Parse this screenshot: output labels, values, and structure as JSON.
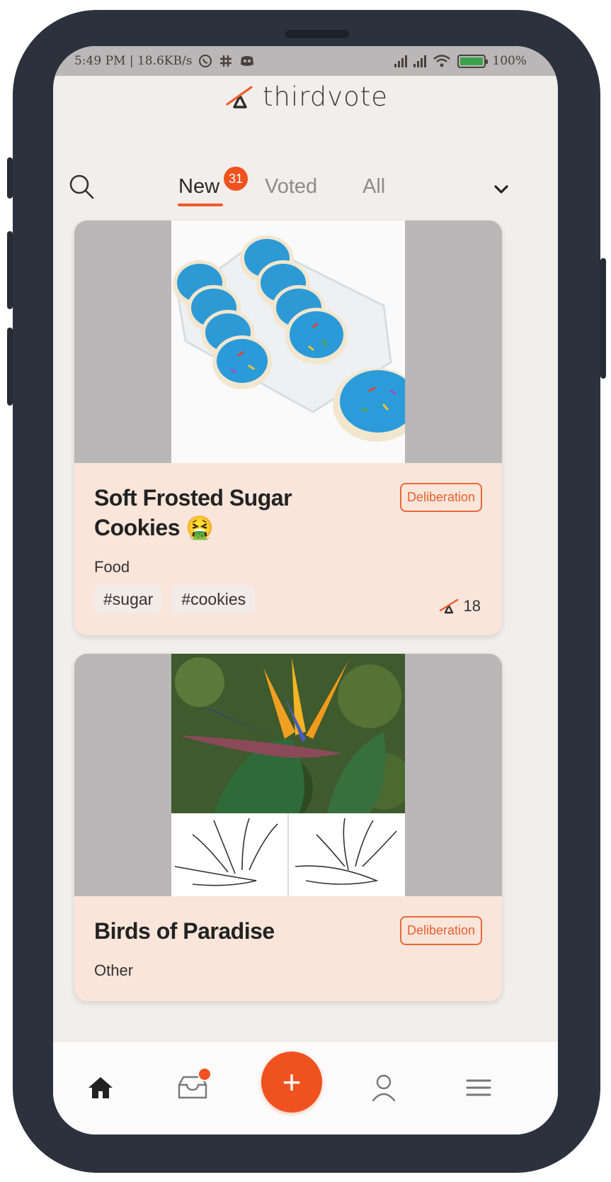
{
  "status_bar": {
    "left_text": "5:49 PM | 18.6KB/s",
    "battery": "100%"
  },
  "brand": {
    "name": "thirdvote"
  },
  "tabs": {
    "items": [
      {
        "label": "New",
        "active": true
      },
      {
        "label": "Voted",
        "active": false
      },
      {
        "label": "All",
        "active": false
      }
    ],
    "new_count": "31"
  },
  "cards": [
    {
      "title": "Soft Frosted Sugar Cookies 🤮",
      "status": "Deliberation",
      "category": "Food",
      "tags": [
        "#sugar",
        "#cookies"
      ],
      "votes": "18"
    },
    {
      "title": "Birds of Paradise",
      "status": "Deliberation",
      "category": "Other",
      "tags": [],
      "votes": ""
    }
  ],
  "colors": {
    "accent": "#f0521f",
    "card_bg": "#f9e5da",
    "screen_bg": "#f1eeeb",
    "phone_frame": "#2b323d"
  },
  "bottom_nav": {
    "items": [
      {
        "icon": "home-icon"
      },
      {
        "icon": "inbox-icon",
        "has_notification": true
      },
      {
        "icon": "plus-icon",
        "label": "+"
      },
      {
        "icon": "profile-icon"
      },
      {
        "icon": "menu-icon"
      }
    ]
  }
}
